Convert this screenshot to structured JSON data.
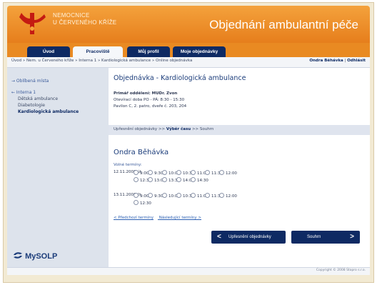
{
  "header": {
    "logo_line1": "NEMOCNICE",
    "logo_line2": "U ČERVENÉHO KŘÍŽE",
    "title": "Objednání ambulantní péče",
    "logo_color": "#c41a12"
  },
  "tabs": [
    {
      "label": "Úvod"
    },
    {
      "label": "Pracoviště"
    },
    {
      "label": "Můj profil"
    },
    {
      "label": "Moje objednávky"
    }
  ],
  "breadcrumb": "Úvod » Nem. u Červeného kříže » Interna 1 » Kardiologická ambulance » Online objednávka",
  "user": {
    "name": "Ondra Běhávka",
    "separator": "|",
    "logout": "Odhlásit"
  },
  "sidebar": {
    "favorites": "→ Oblíbená místa",
    "dept": "← Interna 1",
    "items": [
      "Dětská ambulance",
      "Diabetologie",
      "Kardiologická ambulance"
    ],
    "brand": "MySOLP"
  },
  "main": {
    "title": "Objednávka - Kardiologická ambulance",
    "doctor": "Primář oddělení: MUDr. Zvon",
    "hours": "Otevírací doba PO - PÁ: 8:30 - 15:30",
    "location": "Pavilon C, 2. patro, dveře č. 203, 204",
    "steps": {
      "s1": "Upřesnění objednávky",
      "sep": ">>",
      "s2": "Výběr času",
      "s3": "Souhrn"
    },
    "person": "Ondra Běhávka",
    "free_label": "Volné termíny:",
    "days": [
      {
        "date": "12.11.2008 út",
        "rows": [
          [
            "9:00",
            "9:30",
            "10:00",
            "10:30",
            "11:00",
            "11:30",
            "12:00"
          ],
          [
            "12:30",
            "13:00",
            "13:30",
            "14:00",
            "14:30"
          ]
        ]
      },
      {
        "date": "13.11.2008 čt",
        "rows": [
          [
            "9:00",
            "9:30",
            "10:00",
            "10:30",
            "11:00",
            "11:30",
            "12:00"
          ],
          [
            "12:30"
          ]
        ]
      }
    ],
    "prev_link": "< Předchozí termíny",
    "next_link": "Následující termíny >",
    "back_button": "Upřesnění objednávky",
    "back_arrow": "<",
    "next_button": "Souhrn",
    "next_arrow": ">"
  },
  "footer": "Copyright © 2008 Stapro s.r.o."
}
